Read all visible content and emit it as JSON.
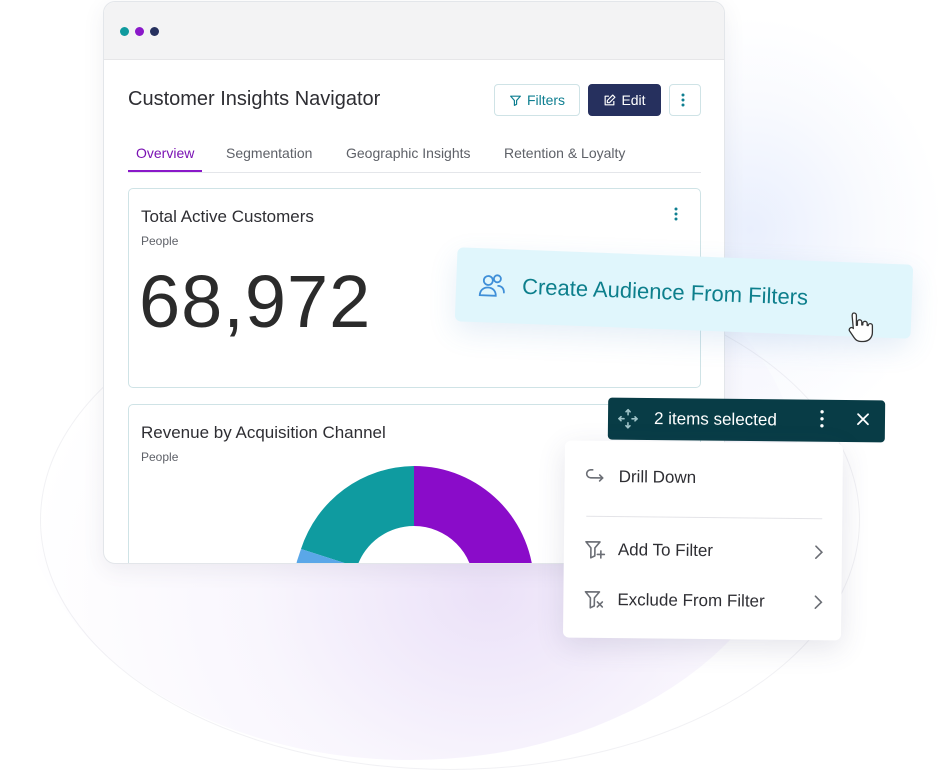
{
  "app": {
    "title": "Customer Insights Navigator",
    "window_dots": [
      "#0f9a9e",
      "#8a18c9",
      "#26305e"
    ]
  },
  "toolbar": {
    "filters_label": "Filters",
    "edit_label": "Edit"
  },
  "tabs": [
    {
      "label": "Overview",
      "active": true
    },
    {
      "label": "Segmentation",
      "active": false
    },
    {
      "label": "Geographic Insights",
      "active": false
    },
    {
      "label": "Retention & Loyalty",
      "active": false
    }
  ],
  "cards": {
    "total_customers": {
      "title": "Total Active Customers",
      "subtitle": "People",
      "value": "68,972"
    },
    "revenue_channel": {
      "title": "Revenue by Acquisition Channel",
      "subtitle": "People",
      "segment_colors": [
        "#8a0cc9",
        "#0f9ba0",
        "#5aa7e8"
      ]
    }
  },
  "audience_action": {
    "label": "Create Audience From Filters",
    "icon": "people-icon"
  },
  "selection": {
    "label": "2 items selected"
  },
  "context_menu": {
    "items": [
      {
        "label": "Drill Down",
        "icon": "drill-down-icon",
        "submenu": false
      },
      {
        "label": "Add To Filter",
        "icon": "filter-add-icon",
        "submenu": true
      },
      {
        "label": "Exclude From Filter",
        "icon": "filter-exclude-icon",
        "submenu": true
      }
    ]
  },
  "colors": {
    "accent_teal": "#0f7f91",
    "accent_purple": "#7a12b3",
    "navy": "#26305e",
    "selection_bar": "#083c46"
  }
}
